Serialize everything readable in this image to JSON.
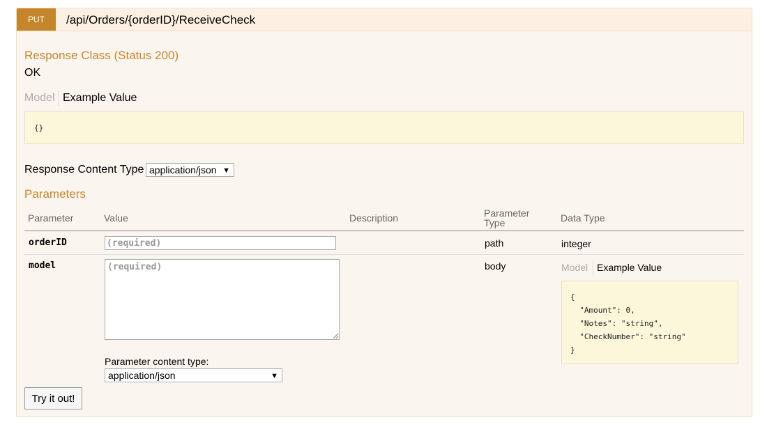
{
  "operation": {
    "method": "PUT",
    "path": "/api/Orders/{orderID}/ReceiveCheck"
  },
  "response_class": {
    "title": "Response Class (Status 200)",
    "status_text": "OK",
    "tab_model": "Model",
    "tab_example": "Example Value",
    "example": "{}"
  },
  "response_content_type": {
    "label": "Response Content Type",
    "selected": "application/json"
  },
  "parameters": {
    "title": "Parameters",
    "headers": {
      "parameter": "Parameter",
      "value": "Value",
      "description": "Description",
      "parameter_type": "Parameter\nType",
      "data_type": "Data Type"
    },
    "rows": [
      {
        "name": "orderID",
        "placeholder": "(required)",
        "parameter_type": "path",
        "data_type": "integer"
      },
      {
        "name": "model",
        "placeholder": "(required)",
        "parameter_type": "body",
        "tab_model": "Model",
        "tab_example": "Example Value",
        "example": "{\n  \"Amount\": 0,\n  \"Notes\": \"string\",\n  \"CheckNumber\": \"string\"\n}",
        "content_type_label": "Parameter content type:",
        "content_type_selected": "application/json"
      }
    ]
  },
  "try_button": "Try it out!",
  "colors": {
    "method_bg": "#c5862b",
    "section_title": "#c5862b",
    "panel_bg": "#fbf5ef",
    "code_bg": "#fcf6db"
  }
}
